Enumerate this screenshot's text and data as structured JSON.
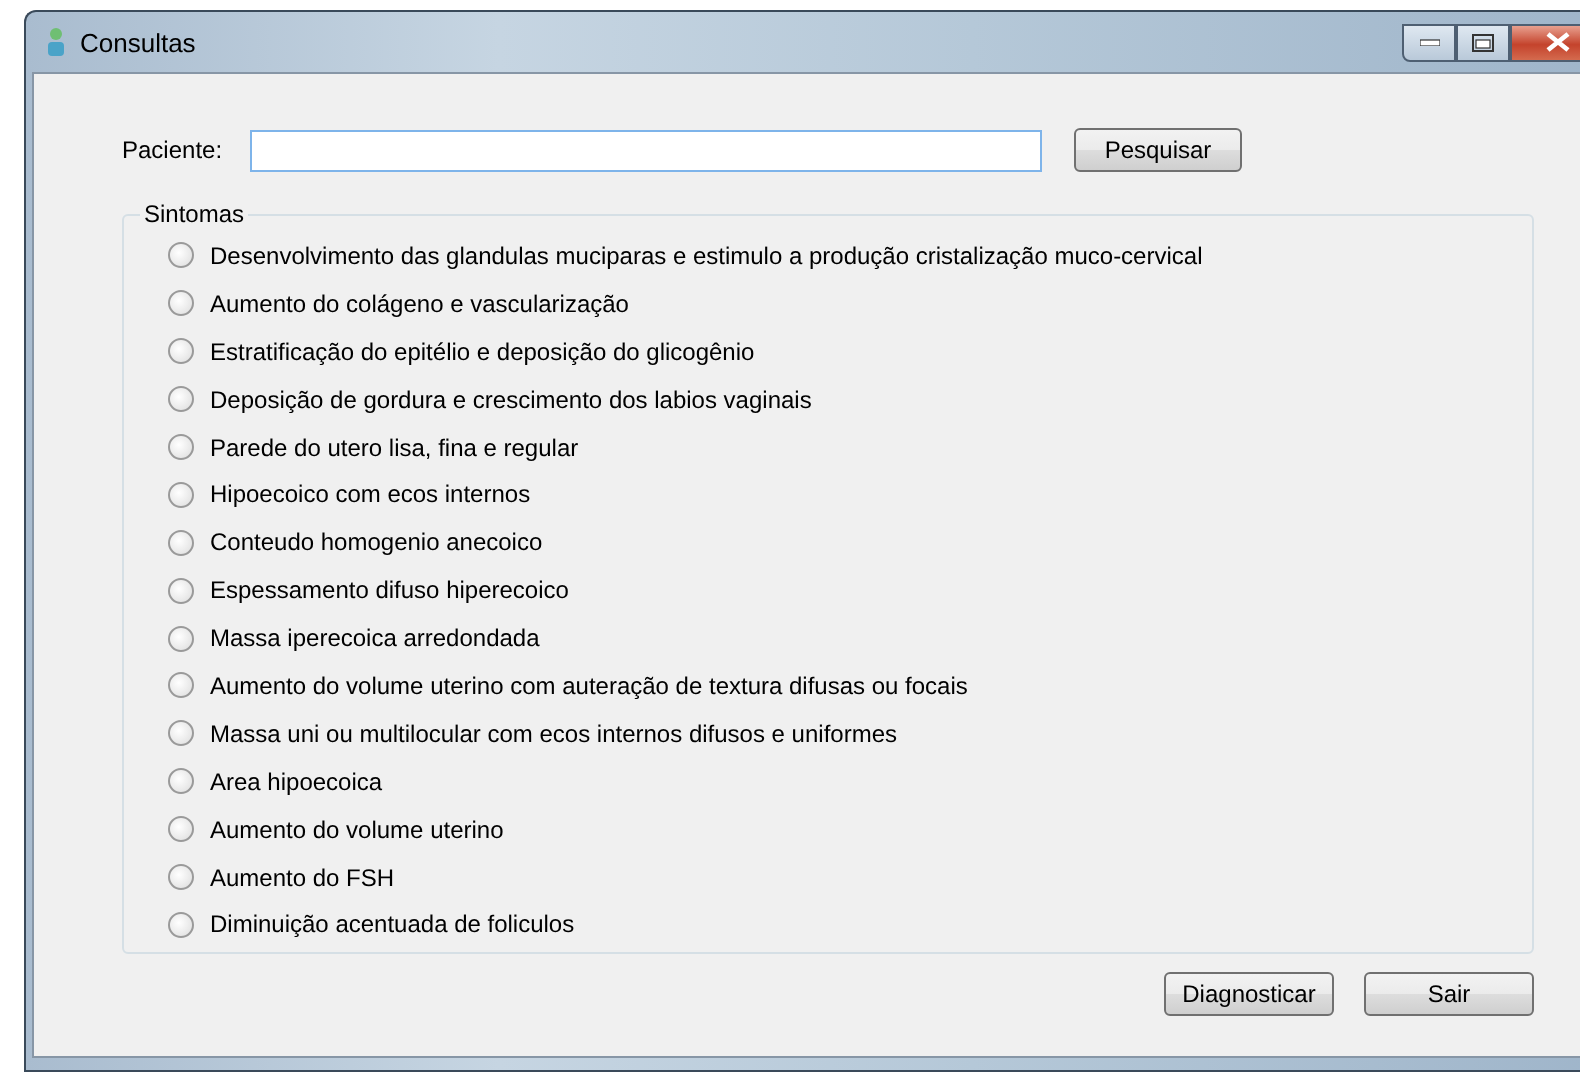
{
  "window": {
    "title": "Consultas"
  },
  "patient": {
    "label": "Paciente:"
  },
  "search_button": "Pesquisar",
  "symptoms": {
    "title": "Sintomas",
    "items": [
      {
        "label": "Desenvolvimento das glandulas muciparas e estimulo a produção cristalização muco-cervical",
        "selected": false
      },
      {
        "label": "Aumento do colágeno e vascularização",
        "selected": false
      },
      {
        "label": "Estratificação do epitélio e deposição do glicogênio",
        "selected": false
      },
      {
        "label": "Deposição de gordura e crescimento dos labios vaginais",
        "selected": false
      },
      {
        "label": "Parede do utero lisa, fina e regular",
        "selected": false
      },
      {
        "label": "Hipoecoico com ecos internos",
        "selected": false
      },
      {
        "label": "Conteudo homogenio anecoico",
        "selected": false
      },
      {
        "label": "Espessamento difuso hiperecoico",
        "selected": false
      },
      {
        "label": "Massa iperecoica arredondada",
        "selected": false
      },
      {
        "label": "Aumento do volume uterino com auteração de textura difusas ou focais",
        "selected": false
      },
      {
        "label": "Massa uni ou multilocular com ecos internos difusos e uniformes",
        "selected": false
      },
      {
        "label": "Area hipoecoica",
        "selected": false
      },
      {
        "label": "Aumento do volume uterino",
        "selected": false
      },
      {
        "label": "Aumento do FSH",
        "selected": false
      },
      {
        "label": "Diminuição acentuada de foliculos",
        "selected": false
      }
    ]
  },
  "buttons": [
    "Diagnosticar",
    "Sair"
  ]
}
